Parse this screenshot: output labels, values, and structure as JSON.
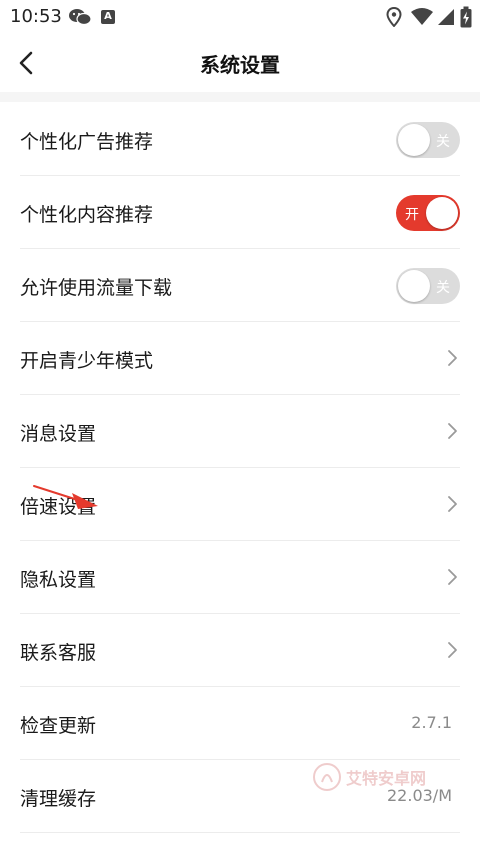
{
  "status_bar": {
    "time": "10:53",
    "a_icon_letter": "A"
  },
  "header": {
    "title": "系统设置"
  },
  "settings": [
    {
      "label": "个性化广告推荐",
      "type": "toggle",
      "state": "off",
      "toggle_text": "关"
    },
    {
      "label": "个性化内容推荐",
      "type": "toggle",
      "state": "on",
      "toggle_text": "开"
    },
    {
      "label": "允许使用流量下载",
      "type": "toggle",
      "state": "off",
      "toggle_text": "关"
    },
    {
      "label": "开启青少年模式",
      "type": "chevron"
    },
    {
      "label": "消息设置",
      "type": "chevron"
    },
    {
      "label": "倍速设置",
      "type": "chevron"
    },
    {
      "label": "隐私设置",
      "type": "chevron"
    },
    {
      "label": "联系客服",
      "type": "chevron"
    },
    {
      "label": "检查更新",
      "type": "value",
      "value": "2.7.1"
    },
    {
      "label": "清理缓存",
      "type": "value",
      "value": "22.03/M"
    }
  ],
  "watermark": {
    "text": "艾特安卓网"
  },
  "colors": {
    "accent": "#e43a2d",
    "toggle_off": "#dcdcdc"
  }
}
